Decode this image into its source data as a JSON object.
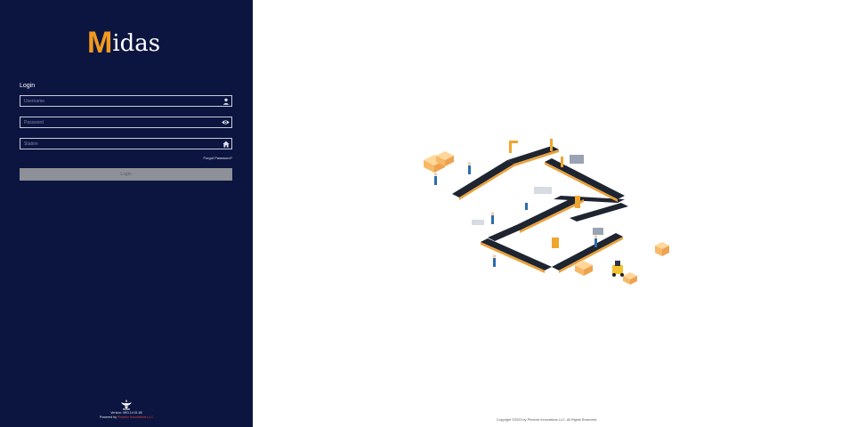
{
  "brand": {
    "logo_initial": "M",
    "logo_rest": "idas",
    "accent_color": "#f39a1f",
    "panel_color": "#0c1540"
  },
  "login": {
    "title": "Login",
    "username_placeholder": "Username",
    "password_placeholder": "Password",
    "station_placeholder": "Station",
    "forgot_password": "Forgot Password?",
    "login_button": "Login"
  },
  "icons": {
    "username": "user-icon",
    "password": "eye-icon",
    "station": "home-icon"
  },
  "footer": {
    "version": "Version: MID.14.01.85",
    "powered_prefix": "Powered by",
    "powered_company": "Phoenix Innovations LLC",
    "copyright": "Copyright ©2023 by Phoenix Innovations LLC. All Rights Reserved."
  }
}
